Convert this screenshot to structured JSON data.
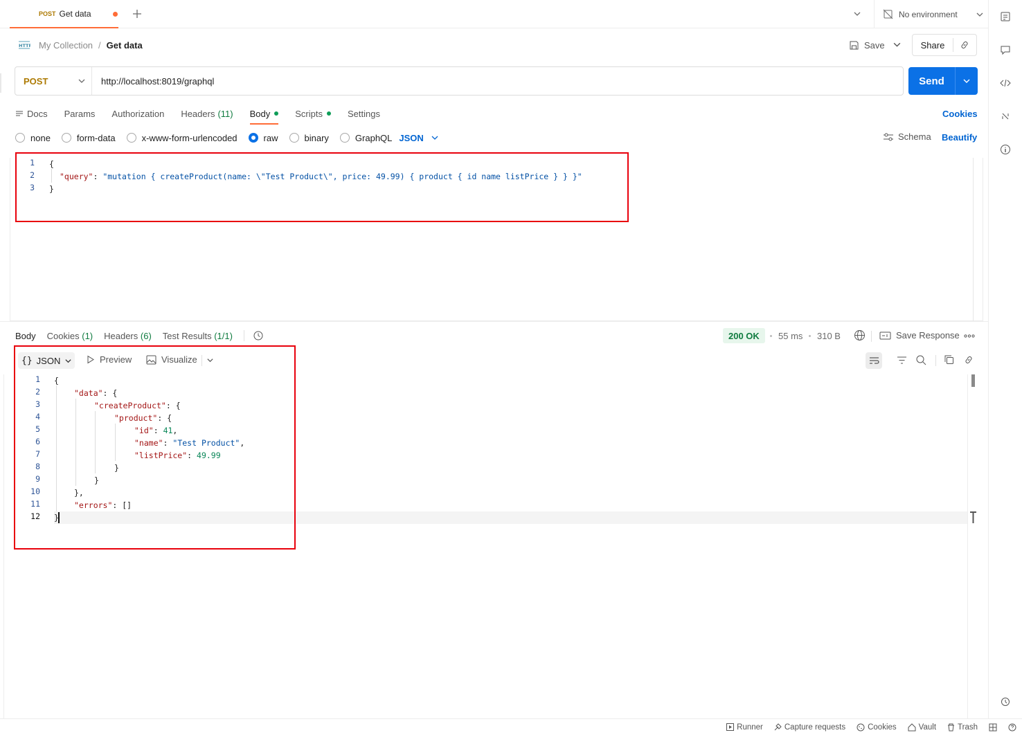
{
  "tab": {
    "method": "POST",
    "title": "Get data"
  },
  "environment": {
    "label": "No environment"
  },
  "breadcrumb": {
    "collection": "My Collection",
    "separator": "/",
    "request": "Get data"
  },
  "toolbar": {
    "save_label": "Save",
    "share_label": "Share"
  },
  "request": {
    "method": "POST",
    "url": "http://localhost:8019/graphql",
    "send_label": "Send"
  },
  "request_tabs": [
    {
      "label": "Docs"
    },
    {
      "label": "Params"
    },
    {
      "label": "Authorization"
    },
    {
      "label": "Headers",
      "count": "(11)"
    },
    {
      "label": "Body"
    },
    {
      "label": "Scripts"
    },
    {
      "label": "Settings"
    }
  ],
  "cookies_link": "Cookies",
  "body_types": [
    "none",
    "form-data",
    "x-www-form-urlencoded",
    "raw",
    "binary",
    "GraphQL"
  ],
  "body_format": "JSON",
  "schema_label": "Schema",
  "beautify_label": "Beautify",
  "request_body": {
    "line_numbers": [
      "1",
      "2",
      "3"
    ],
    "line1": "{",
    "query_key": "\"query\"",
    "colon": ": ",
    "query_value": "\"mutation { createProduct(name: \\\"Test Product\\\", price: 49.99) { product { id name listPrice } } }\"",
    "line3": "}"
  },
  "response_tabs": [
    {
      "label": "Body"
    },
    {
      "label": "Cookies",
      "count": "(1)"
    },
    {
      "label": "Headers",
      "count": "(6)"
    },
    {
      "label": "Test Results",
      "count": "(1/1)"
    }
  ],
  "response_meta": {
    "status": "200 OK",
    "time": "55 ms",
    "size": "310 B",
    "save_response": "Save Response"
  },
  "response_view": {
    "format": "JSON",
    "preview": "Preview",
    "visualize": "Visualize"
  },
  "response_body": {
    "line_numbers": [
      "1",
      "2",
      "3",
      "4",
      "5",
      "6",
      "7",
      "8",
      "9",
      "10",
      "11",
      "12"
    ],
    "data_key": "\"data\"",
    "create_key": "\"createProduct\"",
    "product_key": "\"product\"",
    "id_key": "\"id\"",
    "id_value": "41",
    "name_key": "\"name\"",
    "name_value": "\"Test Product\"",
    "price_key": "\"listPrice\"",
    "price_value": "49.99",
    "errors_key": "\"errors\"",
    "errors_value": "[]"
  },
  "statusbar": [
    "Runner",
    "Capture requests",
    "Cookies",
    "Vault",
    "Trash"
  ]
}
